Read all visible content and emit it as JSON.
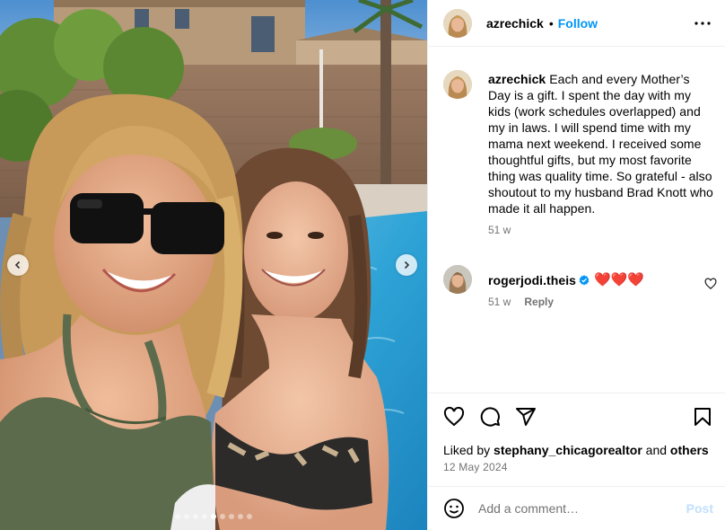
{
  "post": {
    "username": "azrechick",
    "bullet": "•",
    "follow_label": "Follow",
    "more_icon": "more-horizontal-icon"
  },
  "media": {
    "slide_count": 9,
    "active_slide": 4,
    "prev_icon": "chevron-left-icon",
    "next_icon": "chevron-right-icon"
  },
  "caption": {
    "username": "azrechick",
    "text": "Each and every Mother’s Day is a gift. I spent the day with my kids (work schedules overlapped) and my in laws. I will spend time with my mama next weekend. I received some thoughtful gifts, but my most favorite thing was quality time. So grateful - also shoutout to my husband Brad Knott who made it all happen.",
    "time": "51 w"
  },
  "comment": {
    "username": "rogerjodi.theis",
    "text": "❤️❤️❤️",
    "time": "51 w",
    "reply_label": "Reply"
  },
  "actions": {
    "liked_by_prefix": "Liked by ",
    "liked_by_user": "stephany_chicagorealtor",
    "liked_by_and": " and ",
    "liked_by_others": "others",
    "date": "12 May 2024"
  },
  "composer": {
    "placeholder": "Add a comment…",
    "post_label": "Post"
  },
  "colors": {
    "accent": "#0095f6",
    "muted": "#737373",
    "heart": "#e0243a"
  }
}
